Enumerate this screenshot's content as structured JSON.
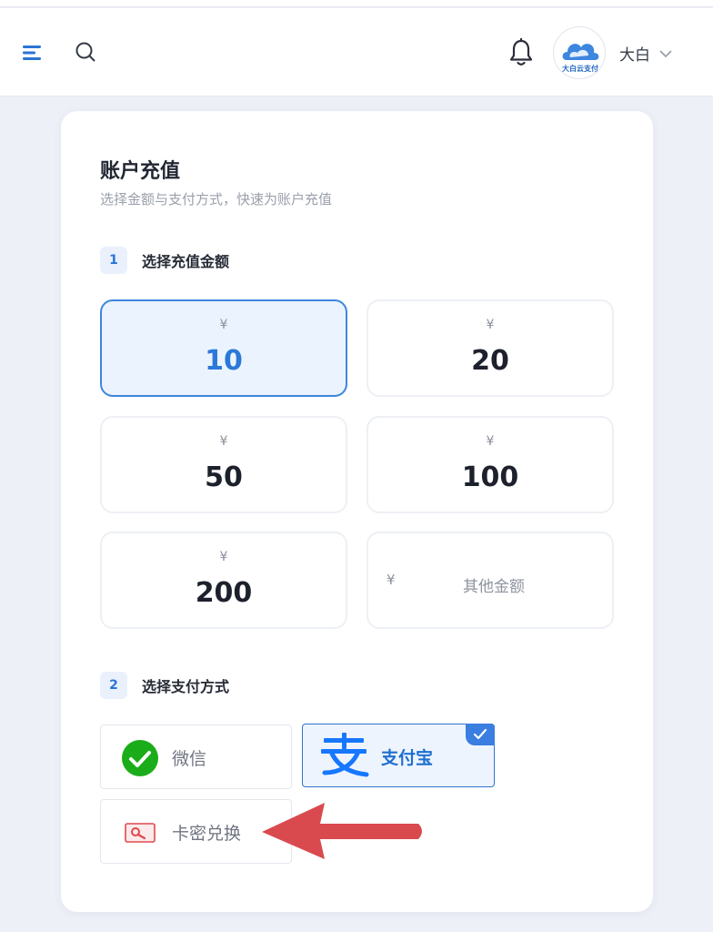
{
  "header": {
    "username": "大白",
    "avatar_label": "大白云支付",
    "icons": [
      "menu-icon",
      "search-icon",
      "bell-icon",
      "chevron-down-icon"
    ]
  },
  "card": {
    "title": "账户充值",
    "subtitle": "选择金额与支付方式，快速为账户充值"
  },
  "steps": [
    {
      "num": "1",
      "label": "选择充值金额"
    },
    {
      "num": "2",
      "label": "选择支付方式"
    }
  ],
  "currency_symbol": "¥",
  "amounts": [
    {
      "value": "10",
      "selected": true
    },
    {
      "value": "20",
      "selected": false
    },
    {
      "value": "50",
      "selected": false
    },
    {
      "value": "100",
      "selected": false
    },
    {
      "value": "200",
      "selected": false
    }
  ],
  "other_amount": {
    "label": "其他金额"
  },
  "payments": [
    {
      "label": "微信",
      "icon": "wechat-icon",
      "selected": false
    },
    {
      "label": "支付宝",
      "icon": "alipay-icon",
      "selected": true
    },
    {
      "label": "卡密兑换",
      "icon": "card-key-icon",
      "selected": false
    }
  ],
  "colors": {
    "accent": "#2b78d9",
    "selected_bg": "#eaf3fe",
    "arrow": "#d94a4f",
    "wechat": "#1aad19",
    "alipay": "#1677ff"
  }
}
